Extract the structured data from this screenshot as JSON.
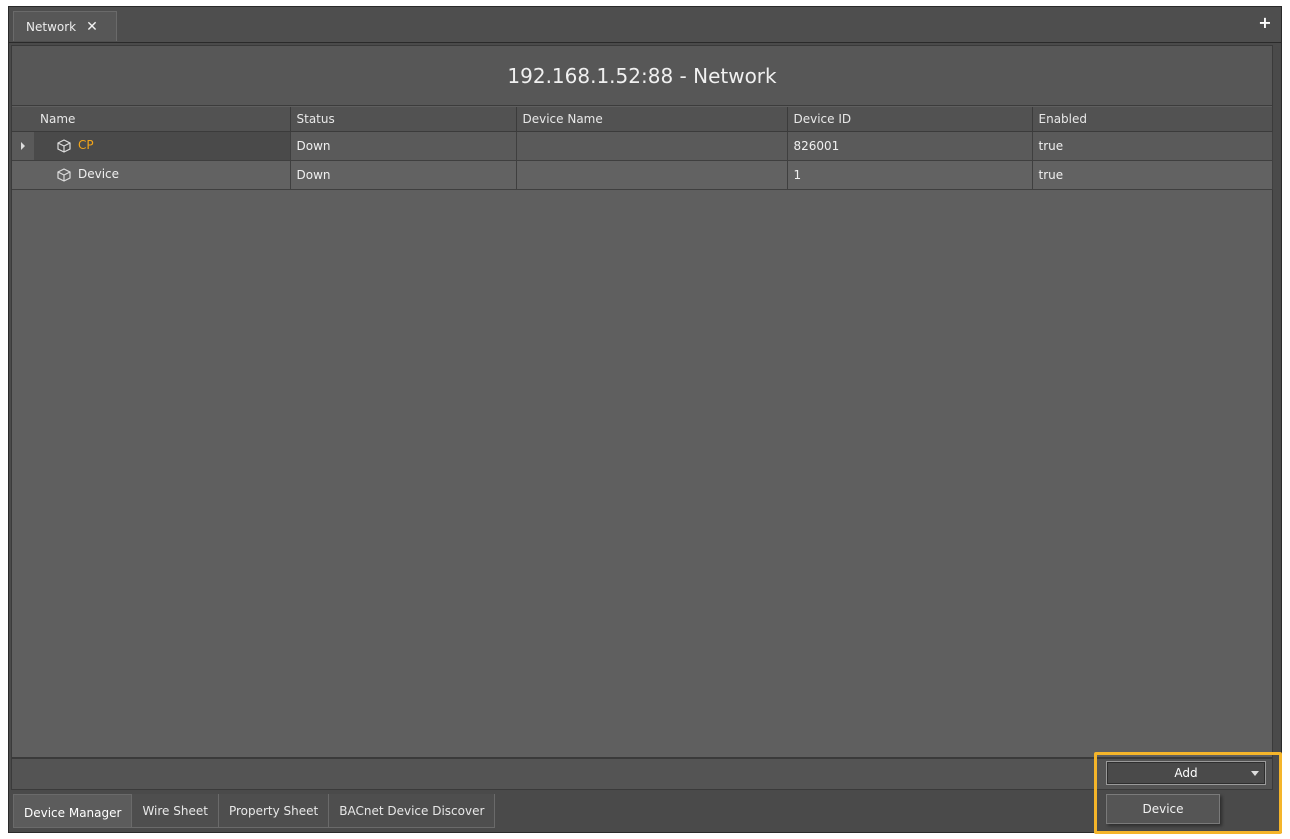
{
  "window_tab": {
    "label": "Network",
    "close": "✕"
  },
  "new_tab": "+",
  "title": "192.168.1.52:88 - Network",
  "table": {
    "columns": [
      "Name",
      "Status",
      "Device Name",
      "Device ID",
      "Enabled"
    ],
    "rows": [
      {
        "name": "CP",
        "status": "Down",
        "device_name": "",
        "device_id": "826001",
        "enabled": "true"
      },
      {
        "name": "Device",
        "status": "Down",
        "device_name": "",
        "device_id": "1",
        "enabled": "true"
      }
    ]
  },
  "bottom_tabs": [
    "Device Manager",
    "Wire Sheet",
    "Property Sheet",
    "BACnet Device Discover"
  ],
  "add_button": {
    "label": "Add"
  },
  "add_menu": {
    "item": "Device"
  },
  "colors": {
    "highlight": "#f5b52a",
    "selected_name": "#f3a519"
  }
}
